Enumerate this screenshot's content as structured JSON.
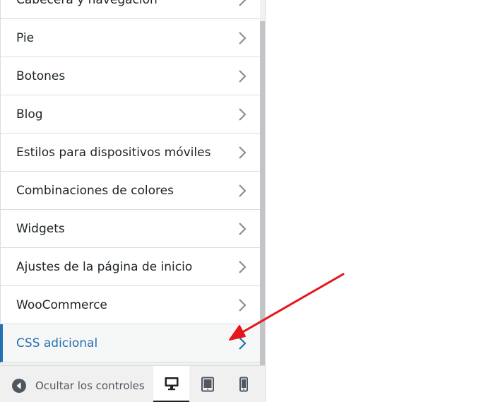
{
  "menu": {
    "items": [
      {
        "label": "Cabecera y navegación"
      },
      {
        "label": "Pie"
      },
      {
        "label": "Botones"
      },
      {
        "label": "Blog"
      },
      {
        "label": "Estilos para dispositivos móviles"
      },
      {
        "label": "Combinaciones de colores"
      },
      {
        "label": "Widgets"
      },
      {
        "label": "Ajustes de la página de inicio"
      },
      {
        "label": "WooCommerce"
      },
      {
        "label": "CSS adicional"
      }
    ],
    "active_index": 9
  },
  "footer": {
    "collapse_label": "Ocultar los controles",
    "devices": [
      "desktop",
      "tablet",
      "mobile"
    ],
    "active_device": "desktop"
  },
  "colors": {
    "accent": "#2271b1",
    "annotation_arrow": "#e6161a"
  }
}
